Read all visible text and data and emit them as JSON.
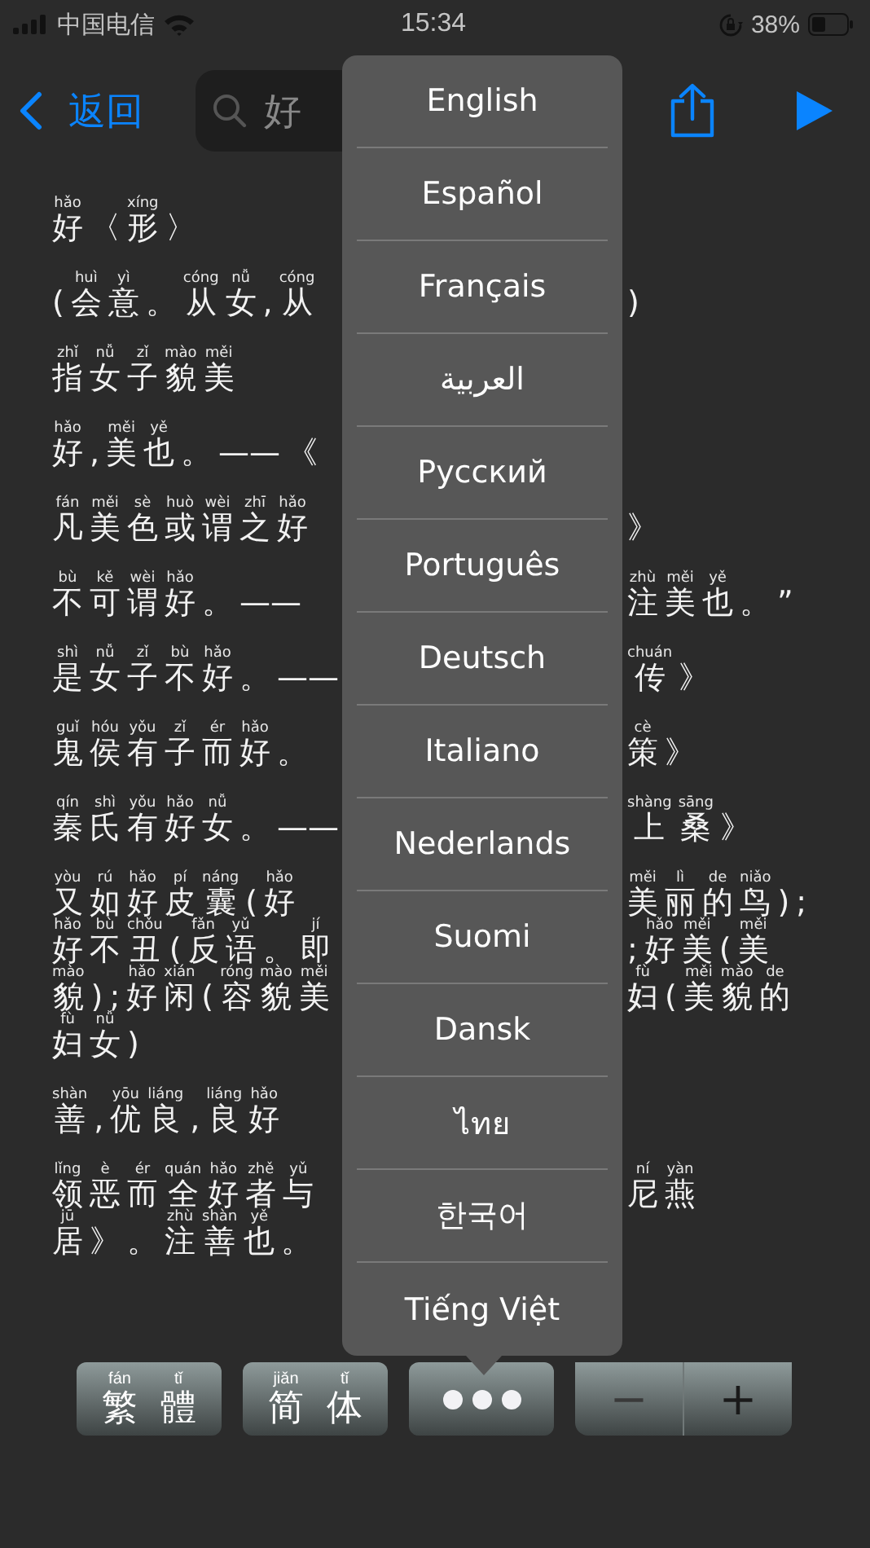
{
  "status_bar": {
    "carrier": "中国电信",
    "time": "15:34",
    "battery": "38%"
  },
  "nav": {
    "back": "返回",
    "search": {
      "value": "好"
    }
  },
  "entry": [
    {
      "lines": [
        {
          "left": [
            {
              "c": "好",
              "py": "hǎo"
            },
            {
              "c": "〈"
            },
            {
              "c": "形",
              "py": "xíng"
            },
            {
              "c": "〉"
            }
          ]
        }
      ]
    },
    {
      "lines": [
        {
          "left": [
            {
              "c": "("
            },
            {
              "c": "会",
              "py": "huì"
            },
            {
              "c": "意",
              "py": "yì"
            },
            {
              "c": "。"
            },
            {
              "c": "从",
              "py": "cóng"
            },
            {
              "c": "女",
              "py": "nǚ"
            },
            {
              "c": ","
            },
            {
              "c": "从",
              "py": "cóng"
            }
          ],
          "right": [
            {
              "c": ")"
            }
          ]
        }
      ]
    },
    {
      "lines": [
        {
          "left": [
            {
              "c": "指",
              "py": "zhǐ"
            },
            {
              "c": "女",
              "py": "nǚ"
            },
            {
              "c": "子",
              "py": "zǐ"
            },
            {
              "c": "貌",
              "py": "mào"
            },
            {
              "c": "美",
              "py": "měi"
            }
          ]
        }
      ]
    },
    {
      "lines": [
        {
          "left": [
            {
              "c": "好",
              "py": "hǎo"
            },
            {
              "c": ","
            },
            {
              "c": "美",
              "py": "měi"
            },
            {
              "c": "也",
              "py": "yě"
            },
            {
              "c": "。"
            },
            {
              "c": "——"
            },
            {
              "c": "《"
            }
          ]
        }
      ]
    },
    {
      "lines": [
        {
          "left": [
            {
              "c": "凡",
              "py": "fán"
            },
            {
              "c": "美",
              "py": "měi"
            },
            {
              "c": "色",
              "py": "sè"
            },
            {
              "c": "或",
              "py": "huò"
            },
            {
              "c": "谓",
              "py": "wèi"
            },
            {
              "c": "之",
              "py": "zhī"
            },
            {
              "c": "好",
              "py": "hǎo"
            }
          ],
          "right": [
            {
              "c": "》"
            }
          ]
        }
      ]
    },
    {
      "lines": [
        {
          "left": [
            {
              "c": "不",
              "py": "bù"
            },
            {
              "c": "可",
              "py": "kě"
            },
            {
              "c": "谓",
              "py": "wèi"
            },
            {
              "c": "好",
              "py": "hǎo"
            },
            {
              "c": "。"
            },
            {
              "c": "——"
            }
          ],
          "right": [
            {
              "c": "注",
              "py": "zhù"
            },
            {
              "c": "美",
              "py": "měi"
            },
            {
              "c": "也",
              "py": "yě"
            },
            {
              "c": "。"
            },
            {
              "c": "”"
            }
          ]
        }
      ]
    },
    {
      "lines": [
        {
          "left": [
            {
              "c": "是",
              "py": "shì"
            },
            {
              "c": "女",
              "py": "nǚ"
            },
            {
              "c": "子",
              "py": "zǐ"
            },
            {
              "c": "不",
              "py": "bù"
            },
            {
              "c": "好",
              "py": "hǎo"
            },
            {
              "c": "。"
            },
            {
              "c": "——"
            }
          ],
          "right": [
            {
              "c": "传",
              "py": "chuán"
            },
            {
              "c": "》"
            }
          ]
        }
      ]
    },
    {
      "lines": [
        {
          "left": [
            {
              "c": "鬼",
              "py": "guǐ"
            },
            {
              "c": "侯",
              "py": "hóu"
            },
            {
              "c": "有",
              "py": "yǒu"
            },
            {
              "c": "子",
              "py": "zǐ"
            },
            {
              "c": "而",
              "py": "ér"
            },
            {
              "c": "好",
              "py": "hǎo"
            },
            {
              "c": "。"
            }
          ],
          "right": [
            {
              "c": "策",
              "py": "cè"
            },
            {
              "c": "》"
            }
          ]
        }
      ]
    },
    {
      "lines": [
        {
          "left": [
            {
              "c": "秦",
              "py": "qín"
            },
            {
              "c": "氏",
              "py": "shì"
            },
            {
              "c": "有",
              "py": "yǒu"
            },
            {
              "c": "好",
              "py": "hǎo"
            },
            {
              "c": "女",
              "py": "nǚ"
            },
            {
              "c": "。"
            },
            {
              "c": "——"
            }
          ],
          "right": [
            {
              "c": "上",
              "py": "shàng"
            },
            {
              "c": "桑",
              "py": "sāng"
            },
            {
              "c": "》"
            }
          ]
        }
      ]
    },
    {
      "lines": [
        {
          "left": [
            {
              "c": "又",
              "py": "yòu"
            },
            {
              "c": "如",
              "py": "rú"
            },
            {
              "c": "好",
              "py": "hǎo"
            },
            {
              "c": "皮",
              "py": "pí"
            },
            {
              "c": "囊",
              "py": "náng"
            },
            {
              "c": "("
            },
            {
              "c": "好",
              "py": "hǎo"
            }
          ],
          "right": [
            {
              "c": "美",
              "py": "měi"
            },
            {
              "c": "丽",
              "py": "lì"
            },
            {
              "c": "的",
              "py": "de"
            },
            {
              "c": "鸟",
              "py": "niǎo"
            },
            {
              "c": ")"
            },
            {
              "c": ";"
            }
          ]
        },
        {
          "left": [
            {
              "c": "好",
              "py": "hǎo"
            },
            {
              "c": "不",
              "py": "bù"
            },
            {
              "c": "丑",
              "py": "chǒu"
            },
            {
              "c": "("
            },
            {
              "c": "反",
              "py": "fǎn"
            },
            {
              "c": "语",
              "py": "yǔ"
            },
            {
              "c": "。"
            },
            {
              "c": "即",
              "py": "jí"
            }
          ],
          "right": [
            {
              "c": ";"
            },
            {
              "c": "好",
              "py": "hǎo"
            },
            {
              "c": "美",
              "py": "měi"
            },
            {
              "c": "("
            },
            {
              "c": "美",
              "py": "měi"
            }
          ]
        },
        {
          "left": [
            {
              "c": "貌",
              "py": "mào"
            },
            {
              "c": ")"
            },
            {
              "c": ";"
            },
            {
              "c": "好",
              "py": "hǎo"
            },
            {
              "c": "闲",
              "py": "xián"
            },
            {
              "c": "("
            },
            {
              "c": "容",
              "py": "róng"
            },
            {
              "c": "貌",
              "py": "mào"
            },
            {
              "c": "美",
              "py": "měi"
            }
          ],
          "right": [
            {
              "c": "妇",
              "py": "fù"
            },
            {
              "c": "("
            },
            {
              "c": "美",
              "py": "měi"
            },
            {
              "c": "貌",
              "py": "mào"
            },
            {
              "c": "的",
              "py": "de"
            }
          ]
        },
        {
          "left": [
            {
              "c": "妇",
              "py": "fù"
            },
            {
              "c": "女",
              "py": "nǚ"
            },
            {
              "c": ")"
            }
          ]
        }
      ]
    },
    {
      "lines": [
        {
          "left": [
            {
              "c": "善",
              "py": "shàn"
            },
            {
              "c": ","
            },
            {
              "c": "优",
              "py": "yōu"
            },
            {
              "c": "良",
              "py": "liáng"
            },
            {
              "c": ","
            },
            {
              "c": "良",
              "py": "liáng"
            },
            {
              "c": "好",
              "py": "hǎo"
            }
          ]
        }
      ]
    },
    {
      "lines": [
        {
          "left": [
            {
              "c": "领",
              "py": "lǐng"
            },
            {
              "c": "恶",
              "py": "è"
            },
            {
              "c": "而",
              "py": "ér"
            },
            {
              "c": "全",
              "py": "quán"
            },
            {
              "c": "好",
              "py": "hǎo"
            },
            {
              "c": "者",
              "py": "zhě"
            },
            {
              "c": "与",
              "py": "yǔ"
            }
          ],
          "right": [
            {
              "c": "尼",
              "py": "ní"
            },
            {
              "c": "燕",
              "py": "yàn"
            }
          ]
        },
        {
          "left": [
            {
              "c": "居",
              "py": "jū"
            },
            {
              "c": "》"
            },
            {
              "c": "。"
            },
            {
              "c": "注",
              "py": "zhù"
            },
            {
              "c": "善",
              "py": "shàn"
            },
            {
              "c": "也",
              "py": "yě"
            },
            {
              "c": "。"
            }
          ]
        }
      ]
    }
  ],
  "language_menu": {
    "items": [
      "English",
      "Español",
      "Français",
      "العربية",
      "Русский",
      "Português",
      "Deutsch",
      "Italiano",
      "Nederlands",
      "Suomi",
      "Dansk",
      "ไทย",
      "한국어",
      "Tiếng Việt"
    ]
  },
  "toolbar": {
    "script_buttons": [
      [
        {
          "c": "繁",
          "py": "fán"
        },
        {
          "c": "體",
          "py": "tǐ"
        }
      ],
      [
        {
          "c": "简",
          "py": "jiǎn"
        },
        {
          "c": "体",
          "py": "tǐ"
        }
      ]
    ],
    "font_size": [
      "−",
      "+"
    ]
  }
}
